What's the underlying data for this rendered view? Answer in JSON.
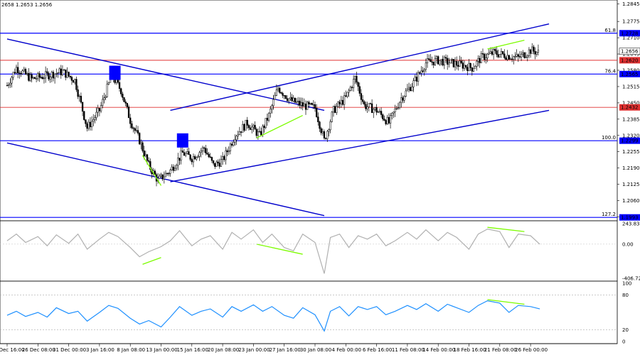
{
  "header": {
    "ohlc": "2658 1.2653 1.2656"
  },
  "colors": {
    "candles": "#000000",
    "trend_lines": "#0000cc",
    "fib_lines": "#0000ff",
    "support_lines": "#e03030",
    "divergence": "#7cfc00",
    "cci": "#b0b0b0",
    "rsi": "#1e90ff",
    "price_label_bg": "#0000ff",
    "current_label_bg": "#ffffff",
    "marker": "#0000ff"
  },
  "chart_data": [
    {
      "type": "candlestick",
      "pane": "price",
      "y_ticks": [
        "1.2845",
        "1.2775",
        "1.2710",
        "1.2645",
        "1.2580",
        "1.2515",
        "1.2450",
        "1.2385",
        "1.2320",
        "1.2255",
        "1.2190",
        "1.2125",
        "1.2060",
        "1.1995"
      ],
      "ylim": [
        1.1985,
        1.2852
      ],
      "x": [
        "20 Dec 16:00",
        "26 Dec 08:00",
        "31 Dec 00:00",
        "3 Jan 16:00",
        "8 Jan 08:00",
        "13 Jan 00:00",
        "15 Jan 16:00",
        "20 Jan 08:00",
        "23 Jan 00:00",
        "27 Jan 16:00",
        "30 Jan 08:00",
        "4 Feb 00:00",
        "6 Feb 16:00",
        "11 Feb 08:00",
        "14 Feb 00:00",
        "18 Feb 16:00",
        "21 Feb 08:00",
        "26 Feb 00:00"
      ],
      "close_path": [
        [
          0,
          1.252
        ],
        [
          0.3,
          1.259
        ],
        [
          0.8,
          1.2545
        ],
        [
          1.3,
          1.256
        ],
        [
          1.8,
          1.2575
        ],
        [
          2.2,
          1.254
        ],
        [
          2.6,
          1.235
        ],
        [
          3.0,
          1.242
        ],
        [
          3.4,
          1.256
        ],
        [
          3.7,
          1.25
        ],
        [
          4.0,
          1.238
        ],
        [
          4.3,
          1.23
        ],
        [
          4.6,
          1.22
        ],
        [
          4.9,
          1.214
        ],
        [
          5.3,
          1.218
        ],
        [
          5.7,
          1.225
        ],
        [
          6.0,
          1.223
        ],
        [
          6.4,
          1.227
        ],
        [
          6.7,
          1.22
        ],
        [
          7.0,
          1.222
        ],
        [
          7.4,
          1.232
        ],
        [
          7.8,
          1.237
        ],
        [
          8.2,
          1.232
        ],
        [
          8.5,
          1.24
        ],
        [
          8.8,
          1.251
        ],
        [
          9.2,
          1.246
        ],
        [
          9.6,
          1.244
        ],
        [
          10.0,
          1.243
        ],
        [
          10.3,
          1.23
        ],
        [
          10.6,
          1.242
        ],
        [
          11.0,
          1.247
        ],
        [
          11.3,
          1.255
        ],
        [
          11.6,
          1.244
        ],
        [
          12.0,
          1.242
        ],
        [
          12.4,
          1.237
        ],
        [
          12.8,
          1.247
        ],
        [
          13.2,
          1.253
        ],
        [
          13.6,
          1.261
        ],
        [
          14.0,
          1.262
        ],
        [
          14.4,
          1.261
        ],
        [
          14.8,
          1.26
        ],
        [
          15.1,
          1.259
        ],
        [
          15.4,
          1.263
        ],
        [
          15.8,
          1.265
        ],
        [
          16.2,
          1.264
        ],
        [
          16.6,
          1.263
        ],
        [
          17.0,
          1.266
        ],
        [
          17.3,
          1.265
        ]
      ],
      "levels": [
        {
          "fib": "61.8",
          "price": 1.2728,
          "label": "1.2728",
          "style": "blue"
        },
        {
          "fib": "",
          "price": 1.262,
          "label": "1.2620",
          "style": "red"
        },
        {
          "fib": "76.4",
          "price": 1.2565,
          "label": "1.2565",
          "style": "blue"
        },
        {
          "fib": "",
          "price": 1.2432,
          "label": "1.2432",
          "style": "red"
        },
        {
          "fib": "100.0",
          "price": 1.2299,
          "label": "1.2299",
          "style": "blue"
        },
        {
          "fib": "127.2",
          "price": 1.1993,
          "label": "1.1993",
          "style": "blue"
        }
      ],
      "current_price": "1.2656",
      "trend_lines": [
        {
          "from": [
            0,
            1.2705
          ],
          "to": [
            10.3,
            1.242
          ]
        },
        {
          "from": [
            0,
            1.229
          ],
          "to": [
            10.3,
            1.2
          ]
        },
        {
          "from": [
            5.3,
            1.242
          ],
          "to": [
            17.6,
            1.2765
          ]
        },
        {
          "from": [
            5.3,
            1.2135
          ],
          "to": [
            17.6,
            1.242
          ]
        }
      ],
      "divergence_lines": [
        {
          "from": [
            4.4,
            1.224
          ],
          "to": [
            5.0,
            1.212
          ]
        },
        {
          "from": [
            8.1,
            1.231
          ],
          "to": [
            9.6,
            1.24
          ]
        },
        {
          "from": [
            15.6,
            1.2665
          ],
          "to": [
            16.8,
            1.27
          ]
        }
      ],
      "markers": [
        {
          "x": 3.5,
          "price": 1.257
        },
        {
          "x": 5.7,
          "price": 1.23
        }
      ]
    },
    {
      "type": "line",
      "pane": "cci",
      "name": "CCI",
      "y_ticks": [
        "243.8374",
        "0.00",
        "-406.729"
      ],
      "ylim": [
        -406.729,
        243.8374
      ],
      "x": [
        0,
        0.3,
        0.6,
        1.0,
        1.3,
        1.6,
        2.0,
        2.3,
        2.6,
        3.0,
        3.3,
        3.6,
        4.0,
        4.3,
        4.6,
        5.0,
        5.3,
        5.6,
        6.0,
        6.3,
        6.6,
        7.0,
        7.3,
        7.6,
        8.0,
        8.3,
        8.6,
        9.0,
        9.3,
        9.6,
        10.0,
        10.3,
        10.5,
        10.8,
        11.1,
        11.4,
        11.7,
        12.0,
        12.3,
        12.6,
        13.0,
        13.3,
        13.6,
        14.0,
        14.3,
        14.6,
        15.0,
        15.3,
        15.6,
        16.0,
        16.3,
        16.6,
        17.0,
        17.3
      ],
      "values": [
        40,
        120,
        20,
        90,
        -20,
        110,
        10,
        120,
        -60,
        60,
        140,
        90,
        -40,
        -150,
        -90,
        -30,
        40,
        160,
        -20,
        60,
        100,
        -60,
        140,
        60,
        170,
        20,
        120,
        -40,
        -80,
        120,
        20,
        -350,
        80,
        120,
        -40,
        100,
        60,
        120,
        -20,
        40,
        140,
        60,
        170,
        40,
        140,
        80,
        -60,
        120,
        180,
        150,
        -40,
        120,
        100,
        0
      ],
      "divergence_lines": [
        {
          "from": [
            4.4,
            -240
          ],
          "to": [
            5.0,
            -160
          ]
        },
        {
          "from": [
            8.1,
            0
          ],
          "to": [
            9.6,
            -120
          ]
        },
        {
          "from": [
            15.6,
            200
          ],
          "to": [
            16.8,
            150
          ]
        }
      ]
    },
    {
      "type": "line",
      "pane": "rsi",
      "name": "RSI",
      "y_ticks": [
        "100",
        "80",
        "20",
        "0"
      ],
      "ylim": [
        0,
        100
      ],
      "x": [
        0,
        0.3,
        0.6,
        1.0,
        1.3,
        1.6,
        2.0,
        2.3,
        2.6,
        3.0,
        3.3,
        3.6,
        4.0,
        4.3,
        4.6,
        5.0,
        5.3,
        5.6,
        6.0,
        6.3,
        6.6,
        7.0,
        7.3,
        7.6,
        8.0,
        8.3,
        8.6,
        9.0,
        9.3,
        9.6,
        10.0,
        10.3,
        10.5,
        10.8,
        11.1,
        11.4,
        11.7,
        12.0,
        12.3,
        12.6,
        13.0,
        13.3,
        13.6,
        14.0,
        14.3,
        14.6,
        15.0,
        15.3,
        15.6,
        16.0,
        16.3,
        16.6,
        17.0,
        17.3
      ],
      "values": [
        45,
        52,
        43,
        50,
        42,
        58,
        48,
        52,
        35,
        50,
        62,
        57,
        40,
        30,
        36,
        25,
        42,
        60,
        45,
        52,
        56,
        42,
        60,
        52,
        63,
        52,
        60,
        45,
        40,
        58,
        46,
        18,
        52,
        60,
        44,
        60,
        55,
        60,
        46,
        52,
        62,
        55,
        65,
        52,
        64,
        58,
        50,
        62,
        70,
        66,
        50,
        62,
        60,
        56
      ],
      "divergence_lines": [
        {
          "from": [
            15.6,
            72
          ],
          "to": [
            16.8,
            64
          ]
        }
      ]
    }
  ]
}
